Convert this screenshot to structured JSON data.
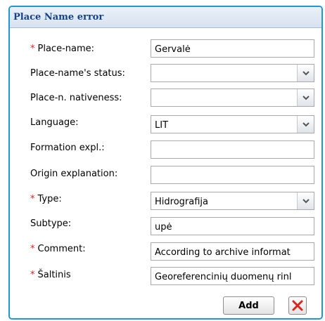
{
  "dialog": {
    "title": "Place Name error"
  },
  "form": {
    "place_name": {
      "required": "*",
      "label": "Place-name:",
      "value": "Gervalė"
    },
    "status": {
      "label": "Place-name's status:",
      "value": ""
    },
    "nativeness": {
      "label": "Place-n. nativeness:",
      "value": ""
    },
    "language": {
      "label": "Language:",
      "value": "LIT"
    },
    "formation": {
      "label": "Formation expl.:",
      "value": ""
    },
    "origin": {
      "label": "Origin explanation:",
      "value": ""
    },
    "type": {
      "required": "*",
      "label": "Type:",
      "value": "Hidrografija"
    },
    "subtype": {
      "label": "Subtype:",
      "value": "upė"
    },
    "comment": {
      "required": "*",
      "label": "Comment:",
      "value": "According to archive informat"
    },
    "source": {
      "required": "*",
      "label": "Šaltinis",
      "value": "Georeferencinių duomenų rinl"
    }
  },
  "buttons": {
    "add_label": "Add",
    "cancel_icon": "close-icon",
    "cancel_color": "#d9251d"
  },
  "colors": {
    "frame": "#1f96d8",
    "title_text": "#15428b",
    "required": "#e02020"
  }
}
